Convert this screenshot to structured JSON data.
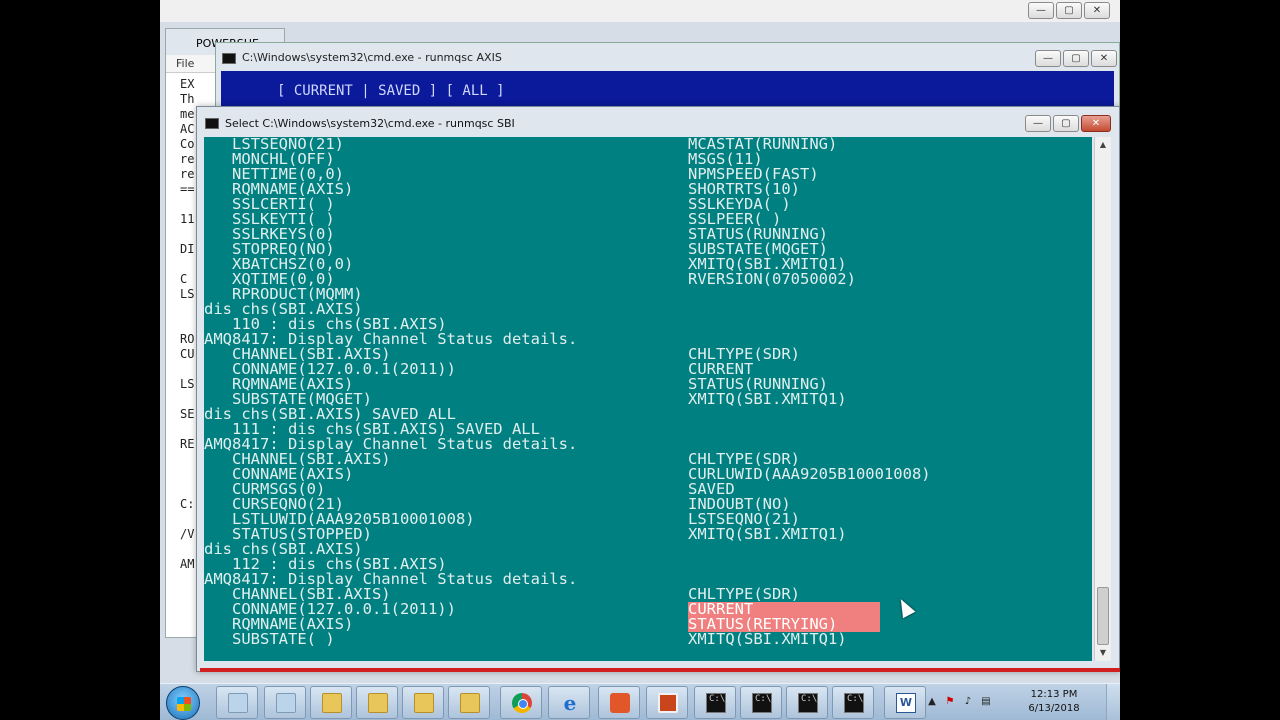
{
  "back_window": {
    "title": "POWERSHE",
    "menu_file": "File",
    "lines": [
      "EX",
      "Th",
      "me",
      "AC",
      "Co",
      "re",
      "re",
      "==",
      "",
      "11",
      "",
      "DI",
      "",
      "C",
      "LS",
      "",
      "",
      "RO",
      "CU",
      "",
      "LS",
      "",
      "SE",
      "",
      "RE",
      "",
      "",
      "",
      "C:",
      "",
      "/V",
      "",
      "AM"
    ]
  },
  "axis_window": {
    "title": "C:\\Windows\\system32\\cmd.exe - runmqsc  AXIS",
    "body_text": "[ CURRENT | SAVED ] [ ALL ]"
  },
  "sbi_window": {
    "title": "Select C:\\Windows\\system32\\cmd.exe - runmqsc  SBI",
    "lines": [
      {
        "l": "   LSTSEQNO(21)",
        "r": "MCASTAT(RUNNING)"
      },
      {
        "l": "   MONCHL(OFF)",
        "r": "MSGS(11)"
      },
      {
        "l": "   NETTIME(0,0)",
        "r": "NPMSPEED(FAST)"
      },
      {
        "l": "   RQMNAME(AXIS)",
        "r": "SHORTRTS(10)"
      },
      {
        "l": "   SSLCERTI( )",
        "r": "SSLKEYDA( )"
      },
      {
        "l": "   SSLKEYTI( )",
        "r": "SSLPEER( )"
      },
      {
        "l": "   SSLRKEYS(0)",
        "r": "STATUS(RUNNING)"
      },
      {
        "l": "   STOPREQ(NO)",
        "r": "SUBSTATE(MQGET)"
      },
      {
        "l": "   XBATCHSZ(0,0)",
        "r": "XMITQ(SBI.XMITQ1)"
      },
      {
        "l": "   XQTIME(0,0)",
        "r": "RVERSION(07050002)"
      },
      {
        "l": "   RPRODUCT(MQMM)",
        "r": ""
      },
      {
        "l": "dis chs(SBI.AXIS)",
        "r": ""
      },
      {
        "l": "   110 : dis chs(SBI.AXIS)",
        "r": ""
      },
      {
        "l": "AMQ8417: Display Channel Status details.",
        "r": ""
      },
      {
        "l": "   CHANNEL(SBI.AXIS)",
        "r": "CHLTYPE(SDR)"
      },
      {
        "l": "   CONNAME(127.0.0.1(2011))",
        "r": "CURRENT"
      },
      {
        "l": "   RQMNAME(AXIS)",
        "r": "STATUS(RUNNING)"
      },
      {
        "l": "   SUBSTATE(MQGET)",
        "r": "XMITQ(SBI.XMITQ1)"
      },
      {
        "l": "dis chs(SBI.AXIS) SAVED ALL",
        "r": ""
      },
      {
        "l": "   111 : dis chs(SBI.AXIS) SAVED ALL",
        "r": ""
      },
      {
        "l": "AMQ8417: Display Channel Status details.",
        "r": ""
      },
      {
        "l": "   CHANNEL(SBI.AXIS)",
        "r": "CHLTYPE(SDR)"
      },
      {
        "l": "   CONNAME(AXIS)",
        "r": "CURLUWID(AAA9205B10001008)"
      },
      {
        "l": "   CURMSGS(0)",
        "r": "SAVED"
      },
      {
        "l": "   CURSEQNO(21)",
        "r": "INDOUBT(NO)"
      },
      {
        "l": "   LSTLUWID(AAA9205B10001008)",
        "r": "LSTSEQNO(21)"
      },
      {
        "l": "   STATUS(STOPPED)",
        "r": "XMITQ(SBI.XMITQ1)"
      },
      {
        "l": "dis chs(SBI.AXIS)",
        "r": ""
      },
      {
        "l": "   112 : dis chs(SBI.AXIS)",
        "r": ""
      },
      {
        "l": "AMQ8417: Display Channel Status details.",
        "r": ""
      },
      {
        "l": "   CHANNEL(SBI.AXIS)",
        "r": "CHLTYPE(SDR)"
      },
      {
        "l": "   CONNAME(127.0.0.1(2011))",
        "r": "CURRENT",
        "highlight": true
      },
      {
        "l": "   RQMNAME(AXIS)",
        "r": "STATUS(RETRYING)",
        "highlight": true
      },
      {
        "l": "   SUBSTATE( )",
        "r": "XMITQ(SBI.XMITQ1)"
      }
    ]
  },
  "window_buttons": {
    "minimize": "—",
    "maximize": "▢",
    "close": "✕"
  },
  "taskbar": {
    "clock_time": "12:13 PM",
    "clock_date": "6/13/2018",
    "term_glyph": "C:\\_",
    "word_glyph": "W",
    "ie_glyph": "e"
  },
  "colors": {
    "console_bg": "#008080",
    "console_text": "#e0eeee",
    "highlight": "#f08080",
    "axis_console_bg": "#0a1a9a"
  }
}
